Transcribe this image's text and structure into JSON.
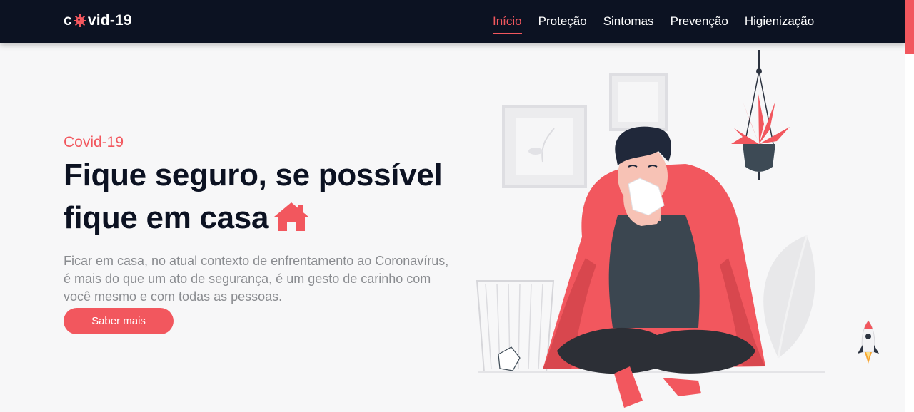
{
  "brand": {
    "prefix": "c",
    "suffix": "vid-19"
  },
  "nav": {
    "items": [
      {
        "label": "Início",
        "active": true
      },
      {
        "label": "Proteção",
        "active": false
      },
      {
        "label": "Sintomas",
        "active": false
      },
      {
        "label": "Prevenção",
        "active": false
      },
      {
        "label": "Higienização",
        "active": false
      }
    ]
  },
  "hero": {
    "eyebrow": "Covid-19",
    "headline_line1": "Fique seguro, se possível",
    "headline_line2": "fique em casa",
    "description": "Ficar em casa, no atual contexto de enfrentamento ao Coronavírus, é mais do que um ato de segurança, é um gesto de carinho com você mesmo e com todas as pessoas.",
    "cta_label": "Saber mais"
  },
  "colors": {
    "accent": "#f2575e",
    "navbar": "#0c1222",
    "heading": "#0c1222",
    "body_text": "#8a8c90"
  },
  "icons": [
    "virus-icon",
    "home-icon",
    "rocket-icon"
  ]
}
